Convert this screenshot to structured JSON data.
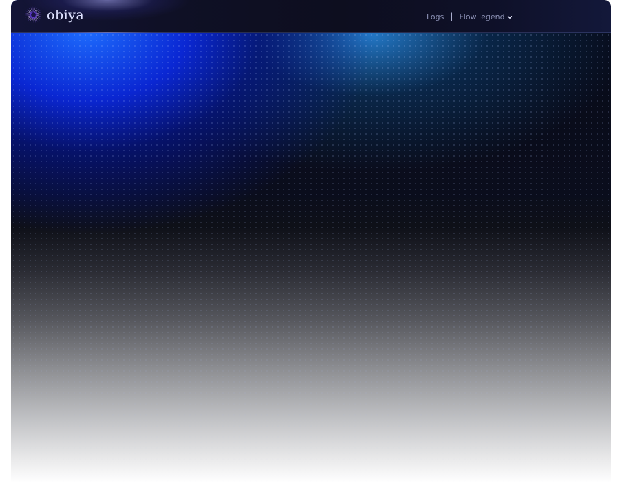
{
  "header": {
    "brand": {
      "name": "obiya",
      "logo_icon": "sunburst-logo-icon",
      "accent": "#7b4dff"
    },
    "nav": {
      "logs_label": "Logs",
      "separator": "|",
      "flow_legend_label": "Flow legend",
      "flow_legend_icon": "chevron-down-icon"
    }
  },
  "theme": {
    "bar_background": "#0f1026",
    "glow_primary": "#1e6eff",
    "glow_secondary": "#2a8ce6",
    "nav_text": "#8b90b4"
  }
}
